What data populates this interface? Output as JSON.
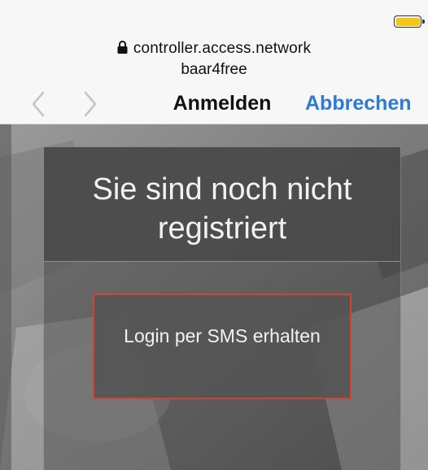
{
  "status_bar": {
    "battery_color": "#f5c518"
  },
  "header": {
    "url": "controller.access.network",
    "network_name": "baar4free",
    "title": "Anmelden",
    "cancel_label": "Abbrechen",
    "accent_color": "#2e7bd1",
    "icons": {
      "lock": "lock-icon",
      "back": "chevron-left-icon",
      "forward": "chevron-right-icon"
    }
  },
  "portal": {
    "heading": "Sie sind noch nicht registriert",
    "sms_button_label": "Login per SMS erhalten",
    "button_border_color": "#d0452d"
  }
}
